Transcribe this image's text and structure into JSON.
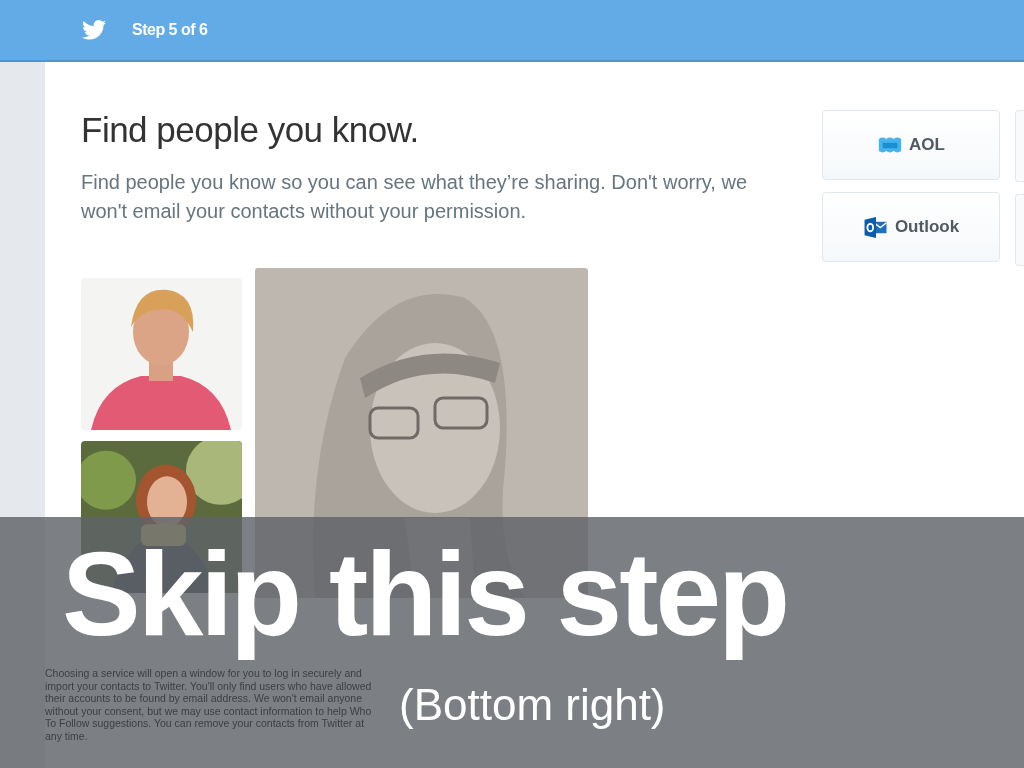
{
  "header": {
    "step": "Step 5 of 6"
  },
  "title": "Find people you know.",
  "subtitle": "Find people you know so you can see what they’re sharing. Don't worry, we won't email your contacts without your permission.",
  "services": [
    {
      "label": "AOL",
      "kind": "aol"
    },
    {
      "label": "Outlook",
      "kind": "outlook"
    }
  ],
  "disclaimer": "Choosing a service will open a window for you to log in securely and import your contacts to Twitter. You'll only find users who have allowed their accounts to be found by email address. We won't email anyone without your consent, but we may use contact information to help Who To Follow suggestions. You can remove your contacts from Twitter at any time.",
  "overlay": {
    "headline": "Skip this step",
    "note": "(Bottom right)"
  }
}
